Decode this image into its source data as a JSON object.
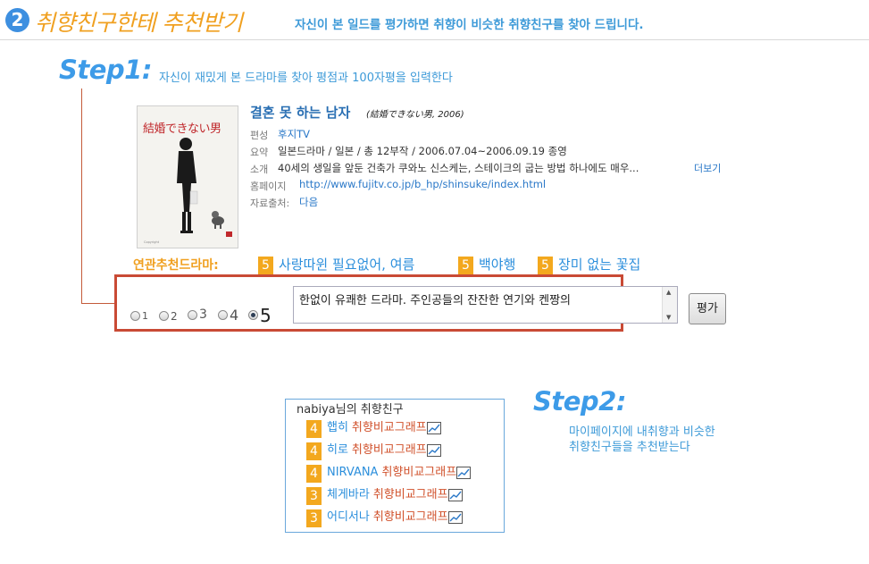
{
  "header": {
    "step_number": "2",
    "title": "취향친구한테 추천받기",
    "subtitle": "자신이 본 일드를 평가하면 취향이 비슷한 취향친구를 찾아 드립니다."
  },
  "step1": {
    "title": "Step1:",
    "description": "자신이 재밌게 본 드라마를 찾아 평점과 100자평을 입력한다"
  },
  "drama": {
    "poster_text": "結婚できない男",
    "title": "결혼 못 하는 남자",
    "original_title": "(結婚できない男, 2006)",
    "rows": [
      {
        "label": "편성",
        "value": "후지TV",
        "is_link": true
      },
      {
        "label": "요약",
        "value": "일본드라마 / 일본 / 총 12부작 / 2006.07.04~2006.09.19 종영",
        "is_link": false
      },
      {
        "label": "소개",
        "value": "40세의 생일을 앞둔 건축가 쿠와노 신스케는, 스테이크의 굽는 방법 하나에도 매우...",
        "is_link": false
      },
      {
        "label": "홈페이지",
        "value": "http://www.fujitv.co.jp/b_hp/shinsuke/index.html",
        "is_link": true
      },
      {
        "label": "자료출처:",
        "value": "다음",
        "is_link": true
      }
    ],
    "more_label": "더보기"
  },
  "related": {
    "label": "연관추천드라마:",
    "items": [
      {
        "score": "5",
        "title": "사랑따윈 필요없어, 여름"
      },
      {
        "score": "5",
        "title": "백야행"
      },
      {
        "score": "5",
        "title": "장미 없는 꽃집"
      }
    ]
  },
  "rating": {
    "options": [
      "1",
      "2",
      "3",
      "4",
      "5"
    ],
    "selected": "5",
    "review_text": "한없이 유쾌한 드라마. 주인공들의 잔잔한 연기와 켄짱의",
    "submit_label": "평가"
  },
  "friends": {
    "user": "nabiya",
    "header_suffix": "님의 취향친구",
    "graph_label": "취향비교그래프",
    "items": [
      {
        "score": "4",
        "name": "햅히"
      },
      {
        "score": "4",
        "name": "히로"
      },
      {
        "score": "4",
        "name": "NIRVANA"
      },
      {
        "score": "3",
        "name": "체게바라"
      },
      {
        "score": "3",
        "name": "어디서나"
      }
    ]
  },
  "step2": {
    "title": "Step2:",
    "description_line1": "마이페이지에 내취향과 비슷한",
    "description_line2": "취향친구들을 추천받는다"
  },
  "colors": {
    "accent_orange": "#f0a020",
    "accent_blue": "#3d9be8",
    "highlight_border": "#c94a35"
  }
}
